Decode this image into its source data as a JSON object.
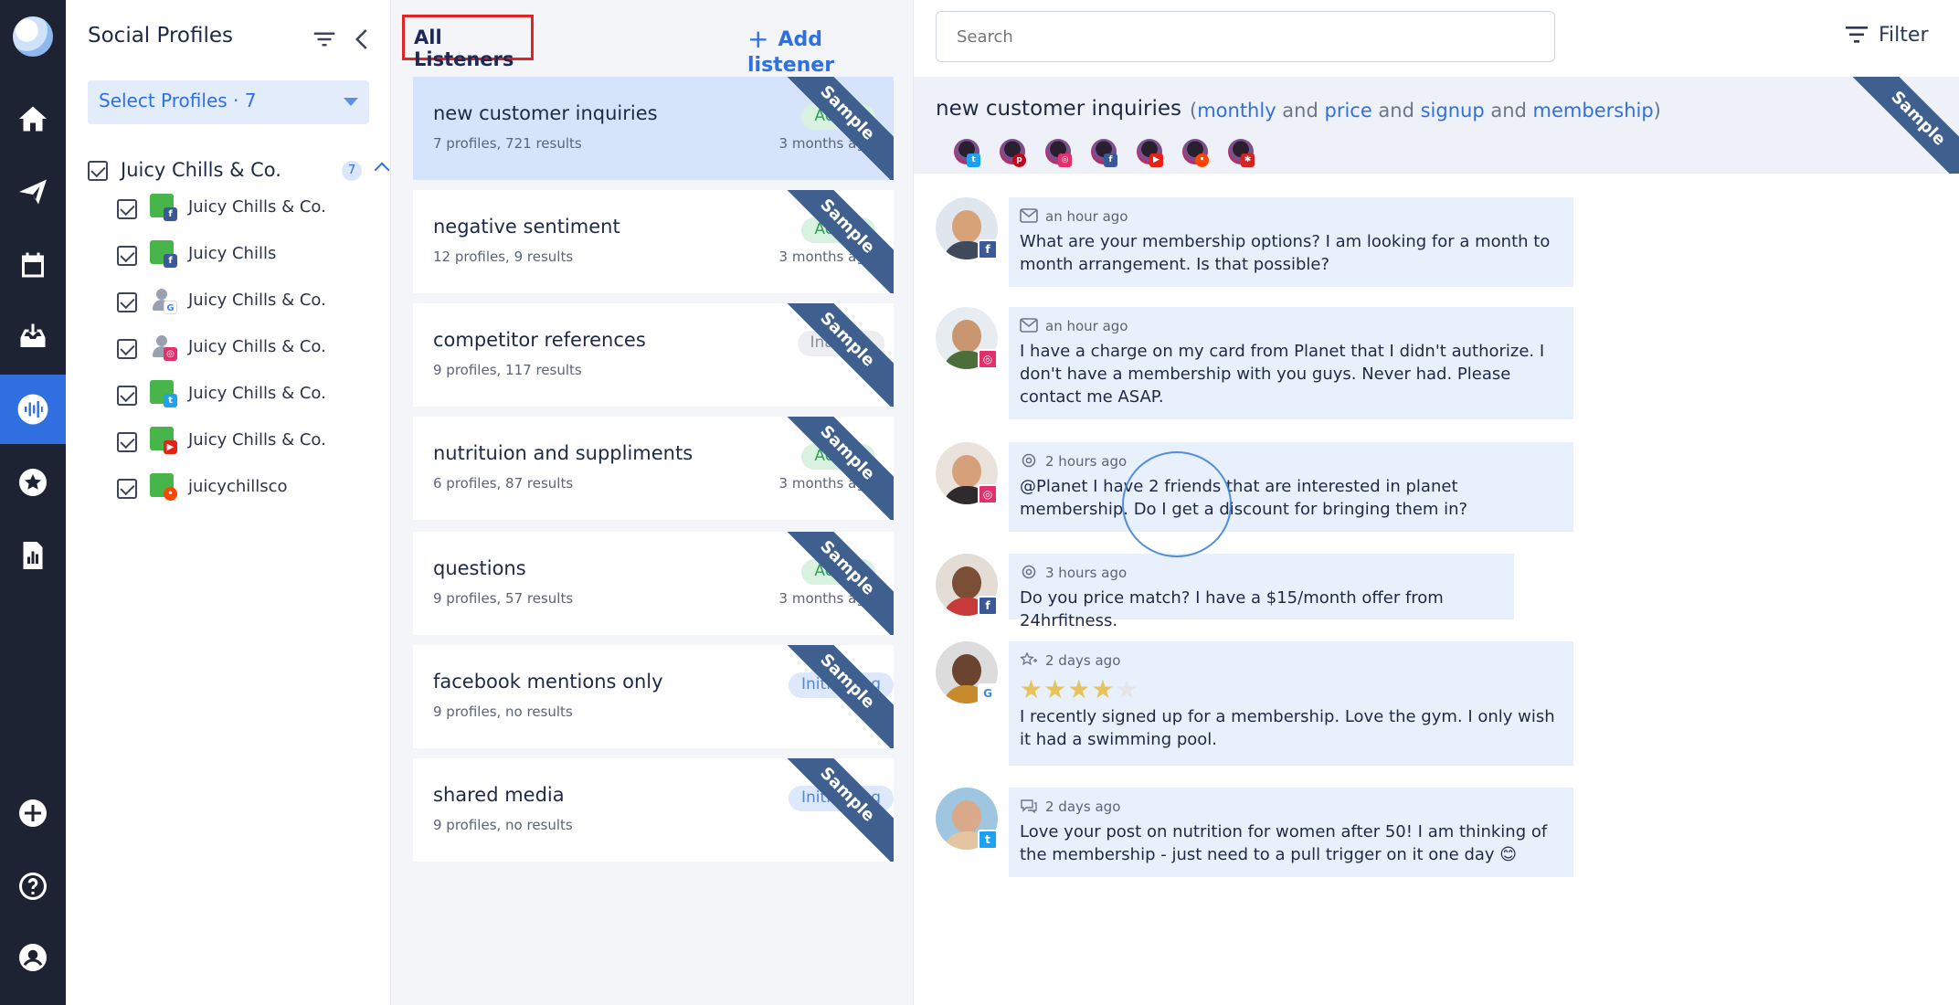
{
  "profiles": {
    "title": "Social Profiles",
    "select_label": "Select Profiles · 7",
    "group": {
      "name": "Juicy Chills & Co.",
      "count": "7"
    },
    "items": [
      {
        "name": "Juicy Chills & Co.",
        "network": "facebook"
      },
      {
        "name": "Juicy Chills",
        "network": "facebook"
      },
      {
        "name": "Juicy Chills & Co.",
        "network": "google"
      },
      {
        "name": "Juicy Chills & Co.",
        "network": "instagram"
      },
      {
        "name": "Juicy Chills & Co.",
        "network": "twitter"
      },
      {
        "name": "Juicy Chills & Co.",
        "network": "youtube"
      },
      {
        "name": "juicychillsco",
        "network": "reddit"
      }
    ]
  },
  "listeners": {
    "title": "All Listeners",
    "add_label": "Add listener",
    "ribbon_label": "Sample",
    "items": [
      {
        "name": "new customer inquiries",
        "meta": "7 profiles, 721 results",
        "status": "Active",
        "time": "3 months ago"
      },
      {
        "name": "negative sentiment",
        "meta": "12 profiles, 9 results",
        "status": "Active",
        "time": "3 months ago"
      },
      {
        "name": "competitor references",
        "meta": "9 profiles, 117 results",
        "status": "Inactive",
        "time": ""
      },
      {
        "name": "nutrituion and suppliments",
        "meta": "6 profiles, 87 results",
        "status": "Active",
        "time": "3 months ago"
      },
      {
        "name": "questions",
        "meta": "9 profiles, 57 results",
        "status": "Active",
        "time": "3 months ago"
      },
      {
        "name": "facebook mentions only",
        "meta": "9 profiles, no results",
        "status": "Initializing",
        "time": ""
      },
      {
        "name": "shared media",
        "meta": "9 profiles, no results",
        "status": "Initializing",
        "time": ""
      }
    ]
  },
  "feed": {
    "search_placeholder": "Search",
    "filter_label": "Filter",
    "title": "new customer inquiries",
    "query": {
      "open": "(",
      "kw1": "monthly",
      "and1": " and ",
      "kw2": "price",
      "and2": " and ",
      "kw3": "signup",
      "and3": " and ",
      "kw4": "membership",
      "close": ")"
    },
    "ribbon_label": "Sample",
    "channels": [
      "twitter",
      "pinterest",
      "instagram",
      "facebook",
      "youtube",
      "reddit",
      "yelp"
    ],
    "messages": [
      {
        "type": "message",
        "time": "an hour ago",
        "network": "facebook",
        "text": "What are your membership options? I am looking for a month to month arrangement. Is that possible?"
      },
      {
        "type": "message",
        "time": "an hour ago",
        "network": "instagram",
        "text": "I have a charge on my card from Planet that I didn't authorize. I don't have a membership with you guys. Never had. Please contact me ASAP."
      },
      {
        "type": "mention",
        "time": "2 hours ago",
        "network": "instagram",
        "text": "@Planet I have 2 friends that are interested in planet membership. Do I get a discount for bringing them in?"
      },
      {
        "type": "mention",
        "time": "3 hours ago",
        "network": "facebook",
        "text": "Do you price match? I have a $15/month offer from 24hrfitness."
      },
      {
        "type": "review",
        "time": "2 days ago",
        "network": "google",
        "rating": 4,
        "text": "I recently signed up for a membership. Love the gym. I only wish it had a swimming pool."
      },
      {
        "type": "comment",
        "time": "2 days ago",
        "network": "twitter",
        "text": "Love your post on nutrition for women after 50! I am thinking of the membership - just need to a pull trigger on it one day 😊"
      }
    ]
  },
  "colors": {
    "accent": "#2f6fe0",
    "rail": "#1d2332",
    "ribbon": "#3f5f8e",
    "selected": "#d6e4fb"
  }
}
